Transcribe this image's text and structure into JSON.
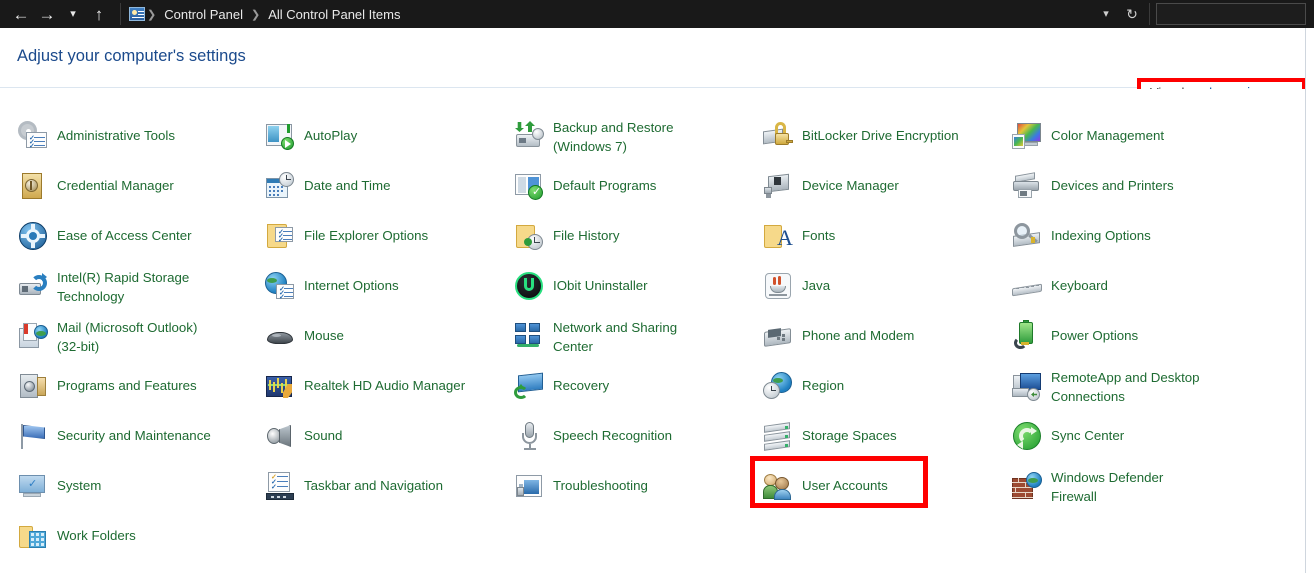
{
  "window": {
    "nav": {
      "back_icon": "arrow-left-icon",
      "forward_icon": "arrow-right-icon",
      "recent_icon": "chevron-down-icon",
      "up_icon": "arrow-up-icon",
      "refresh_icon": "refresh-icon",
      "history_icon": "chevron-down-icon"
    },
    "breadcrumb": {
      "icon": "control-panel-icon",
      "items": [
        "Control Panel",
        "All Control Panel Items"
      ],
      "separator": "❯"
    },
    "search": {
      "placeholder": "",
      "value": ""
    }
  },
  "header": {
    "title": "Adjust your computer's settings",
    "view_by": {
      "label": "View by:",
      "value": "Large icons",
      "caret": "▼",
      "highlight_color": "#fe0000"
    }
  },
  "theme": {
    "titlebar_bg": "#191919",
    "link_color": "#1e6b32",
    "page_title_color": "#1b4a8c",
    "accent_blue": "#1b63b0",
    "highlight_red": "#fe0000"
  },
  "items": [
    {
      "label": "Administrative Tools",
      "icon": "administrative-tools-icon",
      "col": 0,
      "row": 0,
      "lines": 1
    },
    {
      "label": "Credential Manager",
      "icon": "credential-manager-icon",
      "col": 0,
      "row": 1,
      "lines": 1
    },
    {
      "label": "Ease of Access Center",
      "icon": "ease-of-access-center-icon",
      "col": 0,
      "row": 2,
      "lines": 1
    },
    {
      "label": "Intel(R) Rapid Storage\nTechnology",
      "icon": "intel-rapid-storage-icon",
      "col": 0,
      "row": 3,
      "lines": 2
    },
    {
      "label": "Mail (Microsoft Outlook)\n(32-bit)",
      "icon": "mail-outlook-icon",
      "col": 0,
      "row": 4,
      "lines": 2
    },
    {
      "label": "Programs and Features",
      "icon": "programs-and-features-icon",
      "col": 0,
      "row": 5,
      "lines": 1
    },
    {
      "label": "Security and Maintenance",
      "icon": "security-and-maintenance-icon",
      "col": 0,
      "row": 6,
      "lines": 1
    },
    {
      "label": "System",
      "icon": "system-icon",
      "col": 0,
      "row": 7,
      "lines": 1
    },
    {
      "label": "Work Folders",
      "icon": "work-folders-icon",
      "col": 0,
      "row": 8,
      "lines": 1
    },
    {
      "label": "AutoPlay",
      "icon": "autoplay-icon",
      "col": 1,
      "row": 0,
      "lines": 1
    },
    {
      "label": "Date and Time",
      "icon": "date-and-time-icon",
      "col": 1,
      "row": 1,
      "lines": 1
    },
    {
      "label": "File Explorer Options",
      "icon": "file-explorer-options-icon",
      "col": 1,
      "row": 2,
      "lines": 1
    },
    {
      "label": "Internet Options",
      "icon": "internet-options-icon",
      "col": 1,
      "row": 3,
      "lines": 1
    },
    {
      "label": "Mouse",
      "icon": "mouse-icon",
      "col": 1,
      "row": 4,
      "lines": 1
    },
    {
      "label": "Realtek HD Audio Manager",
      "icon": "realtek-hd-audio-manager-icon",
      "col": 1,
      "row": 5,
      "lines": 1
    },
    {
      "label": "Sound",
      "icon": "sound-icon",
      "col": 1,
      "row": 6,
      "lines": 1
    },
    {
      "label": "Taskbar and Navigation",
      "icon": "taskbar-and-navigation-icon",
      "col": 1,
      "row": 7,
      "lines": 1
    },
    {
      "label": "Backup and Restore\n(Windows 7)",
      "icon": "backup-and-restore-icon",
      "col": 2,
      "row": 0,
      "lines": 2
    },
    {
      "label": "Default Programs",
      "icon": "default-programs-icon",
      "col": 2,
      "row": 1,
      "lines": 1
    },
    {
      "label": "File History",
      "icon": "file-history-icon",
      "col": 2,
      "row": 2,
      "lines": 1
    },
    {
      "label": "IObit Uninstaller",
      "icon": "iobit-uninstaller-icon",
      "col": 2,
      "row": 3,
      "lines": 1
    },
    {
      "label": "Network and Sharing\nCenter",
      "icon": "network-and-sharing-icon",
      "col": 2,
      "row": 4,
      "lines": 2
    },
    {
      "label": "Recovery",
      "icon": "recovery-icon",
      "col": 2,
      "row": 5,
      "lines": 1
    },
    {
      "label": "Speech Recognition",
      "icon": "speech-recognition-icon",
      "col": 2,
      "row": 6,
      "lines": 1
    },
    {
      "label": "Troubleshooting",
      "icon": "troubleshooting-icon",
      "col": 2,
      "row": 7,
      "lines": 1
    },
    {
      "label": "BitLocker Drive Encryption",
      "icon": "bitlocker-drive-encryption-icon",
      "col": 3,
      "row": 0,
      "lines": 1
    },
    {
      "label": "Device Manager",
      "icon": "device-manager-icon",
      "col": 3,
      "row": 1,
      "lines": 1
    },
    {
      "label": "Fonts",
      "icon": "fonts-icon",
      "col": 3,
      "row": 2,
      "lines": 1
    },
    {
      "label": "Java",
      "icon": "java-icon",
      "col": 3,
      "row": 3,
      "lines": 1
    },
    {
      "label": "Phone and Modem",
      "icon": "phone-and-modem-icon",
      "col": 3,
      "row": 4,
      "lines": 1
    },
    {
      "label": "Region",
      "icon": "region-icon",
      "col": 3,
      "row": 5,
      "lines": 1
    },
    {
      "label": "Storage Spaces",
      "icon": "storage-spaces-icon",
      "col": 3,
      "row": 6,
      "lines": 1
    },
    {
      "label": "User Accounts",
      "icon": "user-accounts-icon",
      "col": 3,
      "row": 7,
      "lines": 1,
      "highlighted": true
    },
    {
      "label": "Color Management",
      "icon": "color-management-icon",
      "col": 4,
      "row": 0,
      "lines": 1
    },
    {
      "label": "Devices and Printers",
      "icon": "devices-and-printers-icon",
      "col": 4,
      "row": 1,
      "lines": 1
    },
    {
      "label": "Indexing Options",
      "icon": "indexing-options-icon",
      "col": 4,
      "row": 2,
      "lines": 1
    },
    {
      "label": "Keyboard",
      "icon": "keyboard-icon",
      "col": 4,
      "row": 3,
      "lines": 1
    },
    {
      "label": "Power Options",
      "icon": "power-options-icon",
      "col": 4,
      "row": 4,
      "lines": 1
    },
    {
      "label": "RemoteApp and Desktop\nConnections",
      "icon": "remoteapp-and-desktop-icon",
      "col": 4,
      "row": 5,
      "lines": 2
    },
    {
      "label": "Sync Center",
      "icon": "sync-center-icon",
      "col": 4,
      "row": 6,
      "lines": 1
    },
    {
      "label": "Windows Defender\nFirewall",
      "icon": "windows-defender-firewall-icon",
      "col": 4,
      "row": 7,
      "lines": 2
    }
  ]
}
